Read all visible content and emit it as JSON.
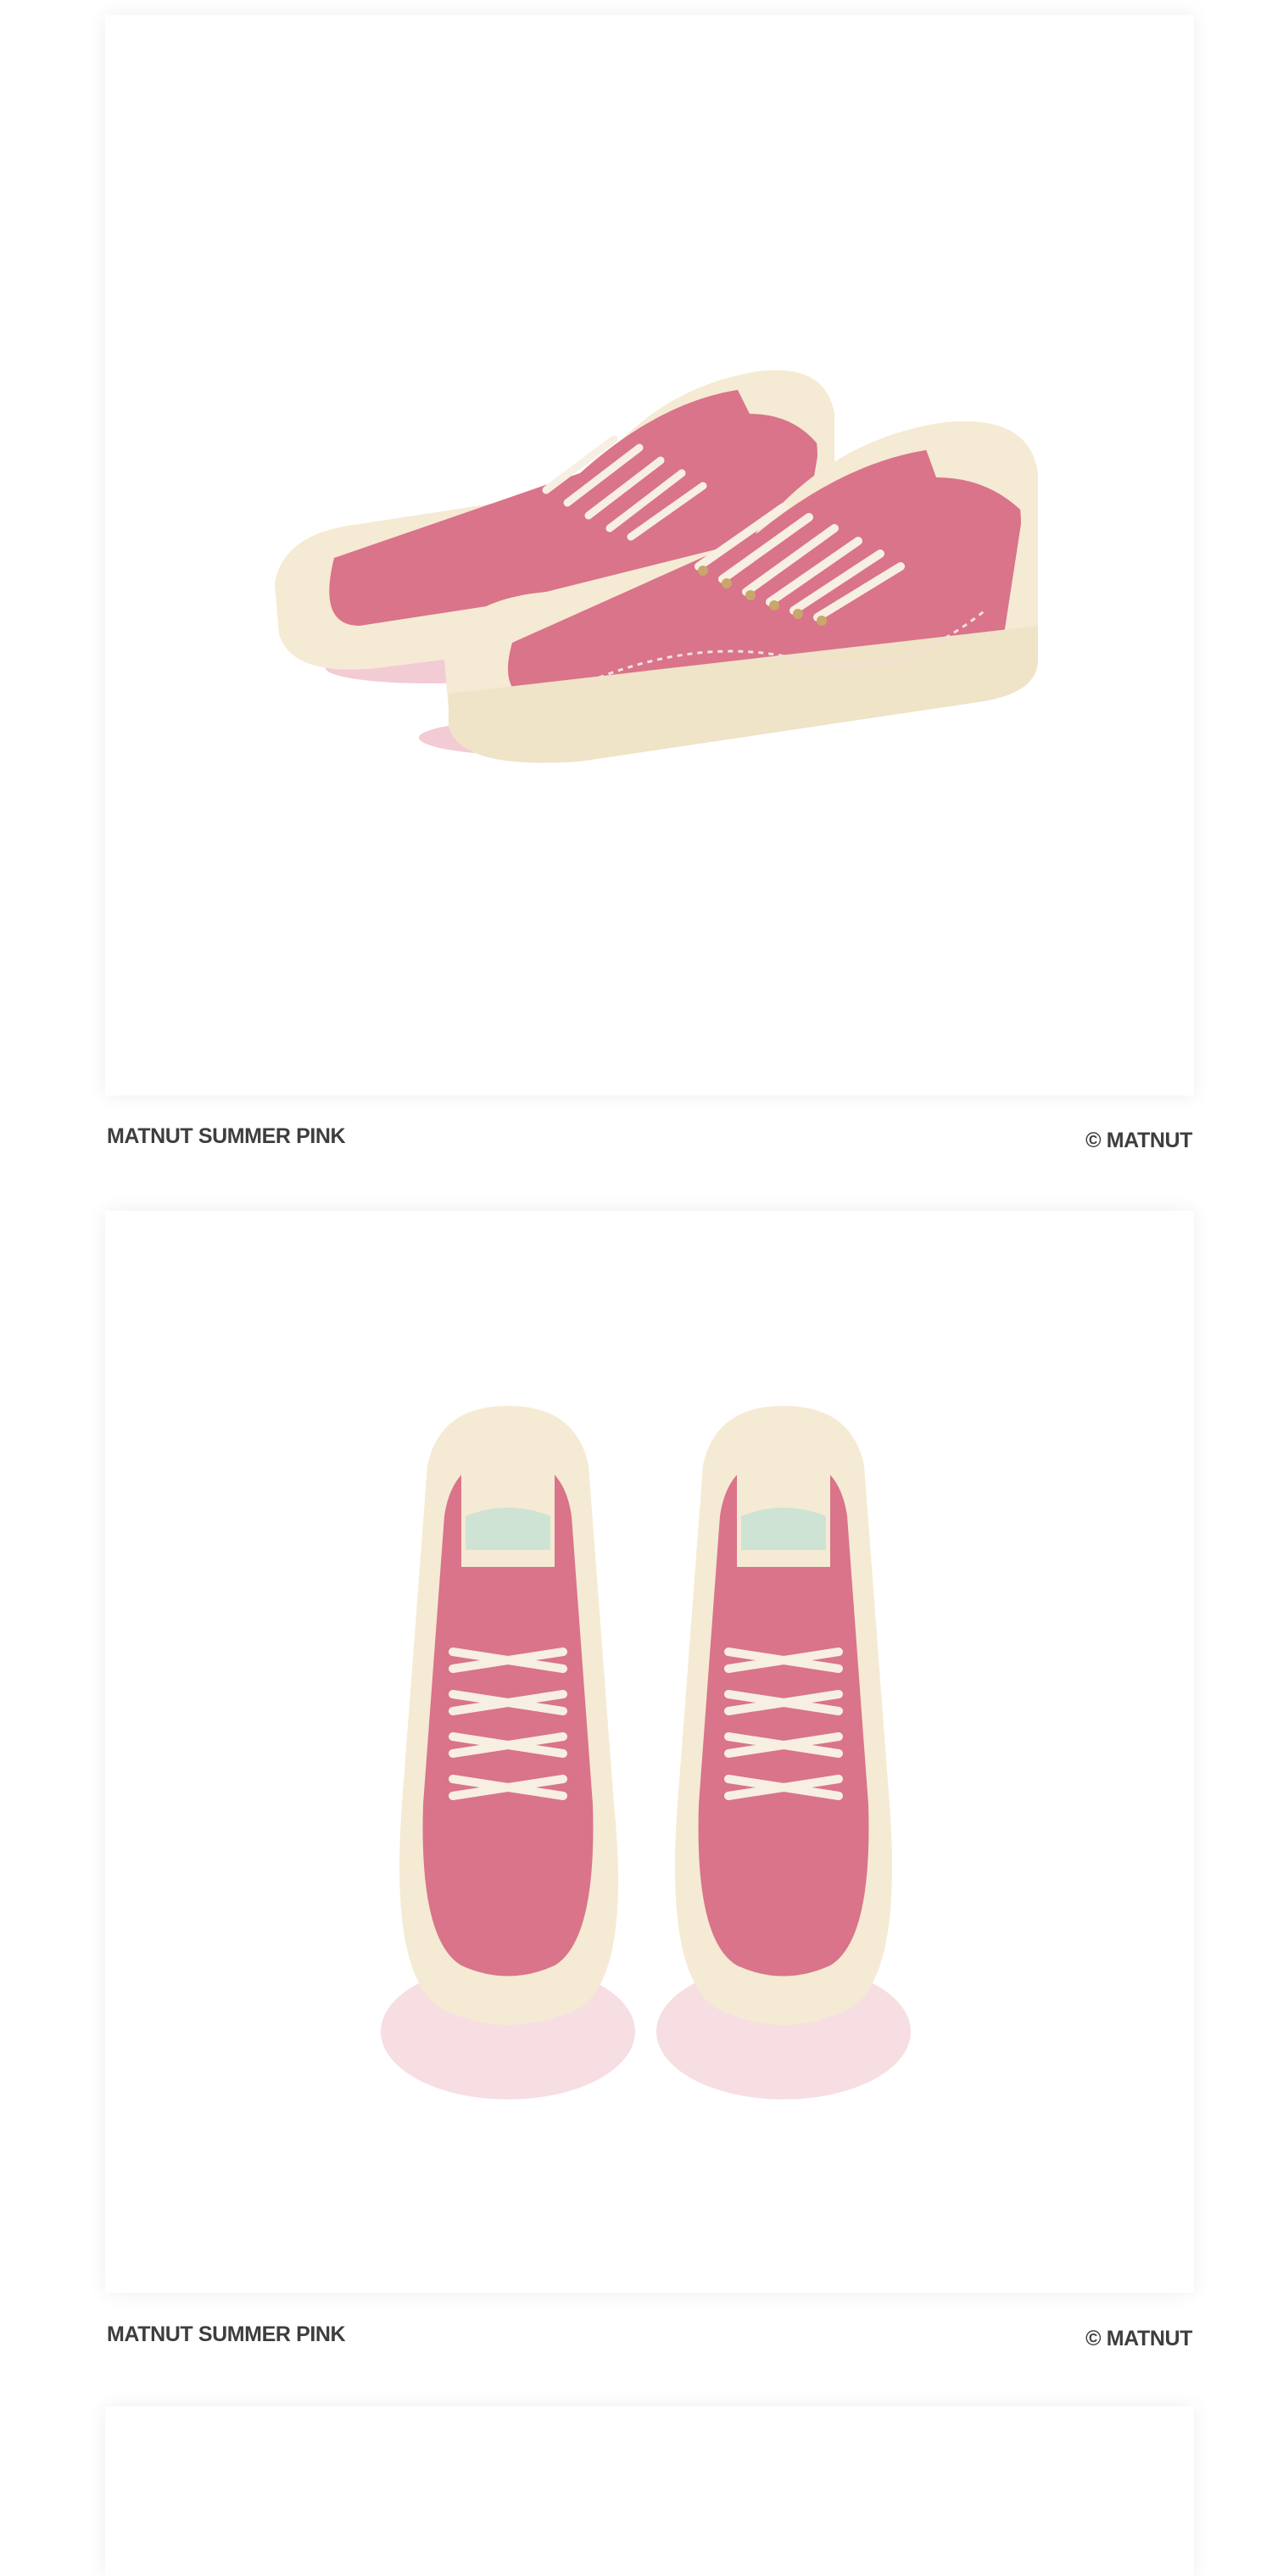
{
  "gallery": {
    "items": [
      {
        "image_alt": "Pink and cream low-top sneakers, side view",
        "title": "MATNUT SUMMER PINK",
        "credit": "© MATNUT"
      },
      {
        "image_alt": "Pink and cream low-top sneakers, top view",
        "title": "MATNUT SUMMER PINK",
        "credit": "© MATNUT"
      },
      {
        "image_alt": "Next gallery image (partially visible)"
      }
    ]
  },
  "colors": {
    "shoe_pink": "#d9748a",
    "shoe_cream": "#f5ead3",
    "caption_text": "#3e3e3e",
    "card_bg": "#ffffff"
  }
}
